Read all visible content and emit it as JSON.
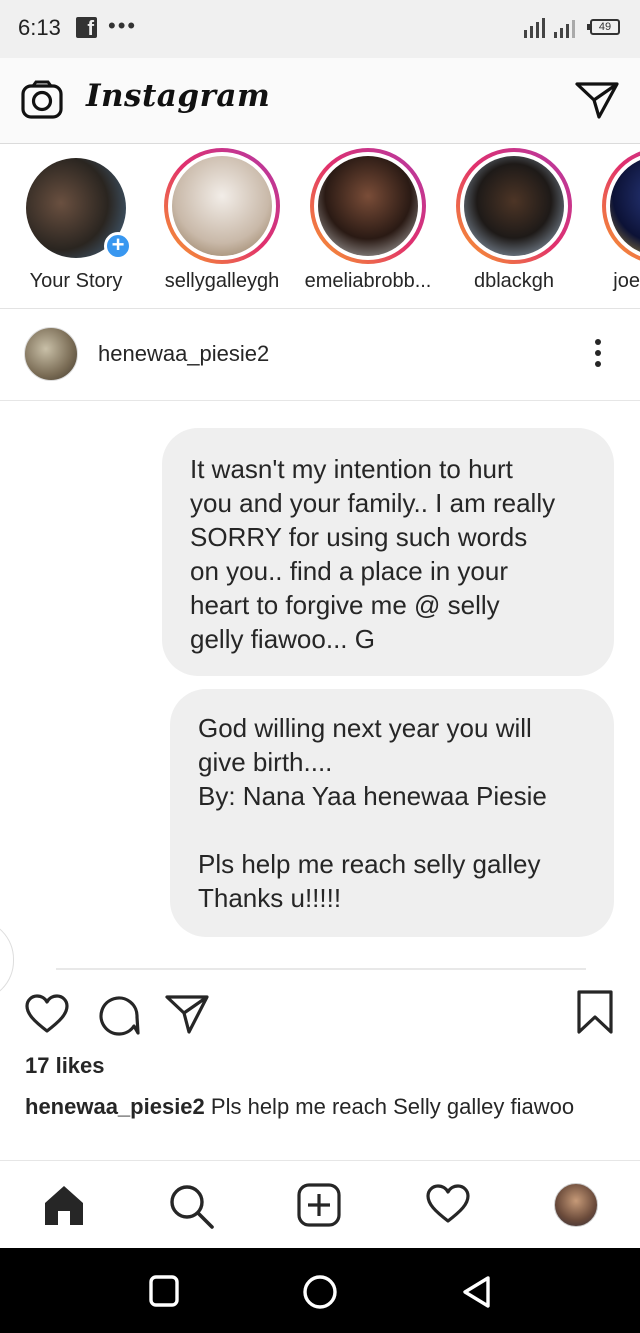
{
  "status_bar": {
    "time": "6:13",
    "notification_icons": [
      "facebook-icon",
      "more-dots"
    ],
    "dots": "•••",
    "battery": "49"
  },
  "header": {
    "logo_text": "Instagram",
    "left_icon": "camera-icon",
    "right_icon": "direct-message-icon"
  },
  "stories": [
    {
      "label": "Your Story",
      "own": true
    },
    {
      "label": "sellygalleygh"
    },
    {
      "label": "emeliabrobb..."
    },
    {
      "label": "dblackgh"
    },
    {
      "label": "joe"
    }
  ],
  "post": {
    "username": "henewaa_piesie2",
    "messages": [
      "It wasn't my intention to hurt\nyou and your family.. I am really\nSORRY for using such words\non you.. find a place in your\nheart to forgive me @ selly\ngelly fiawoo... G",
      "God willing next year you will\ngive birth....\nBy: Nana Yaa henewaa Piesie\n\nPls help me reach selly galley\nThanks u!!!!!"
    ],
    "likes": "17 likes",
    "caption_user": "henewaa_piesie2",
    "caption_text": "Pls help me reach Selly galley fiawoo"
  },
  "bottom_nav": [
    "home-icon",
    "search-icon",
    "new-post-icon",
    "activity-icon",
    "profile-avatar"
  ],
  "system_nav": [
    "recents-button",
    "home-button",
    "back-button"
  ],
  "colors": {
    "story_ring_start": "#f9a12b",
    "story_ring_end": "#b13aa8",
    "add_badge": "#3897f0",
    "bubble": "#efefef"
  }
}
